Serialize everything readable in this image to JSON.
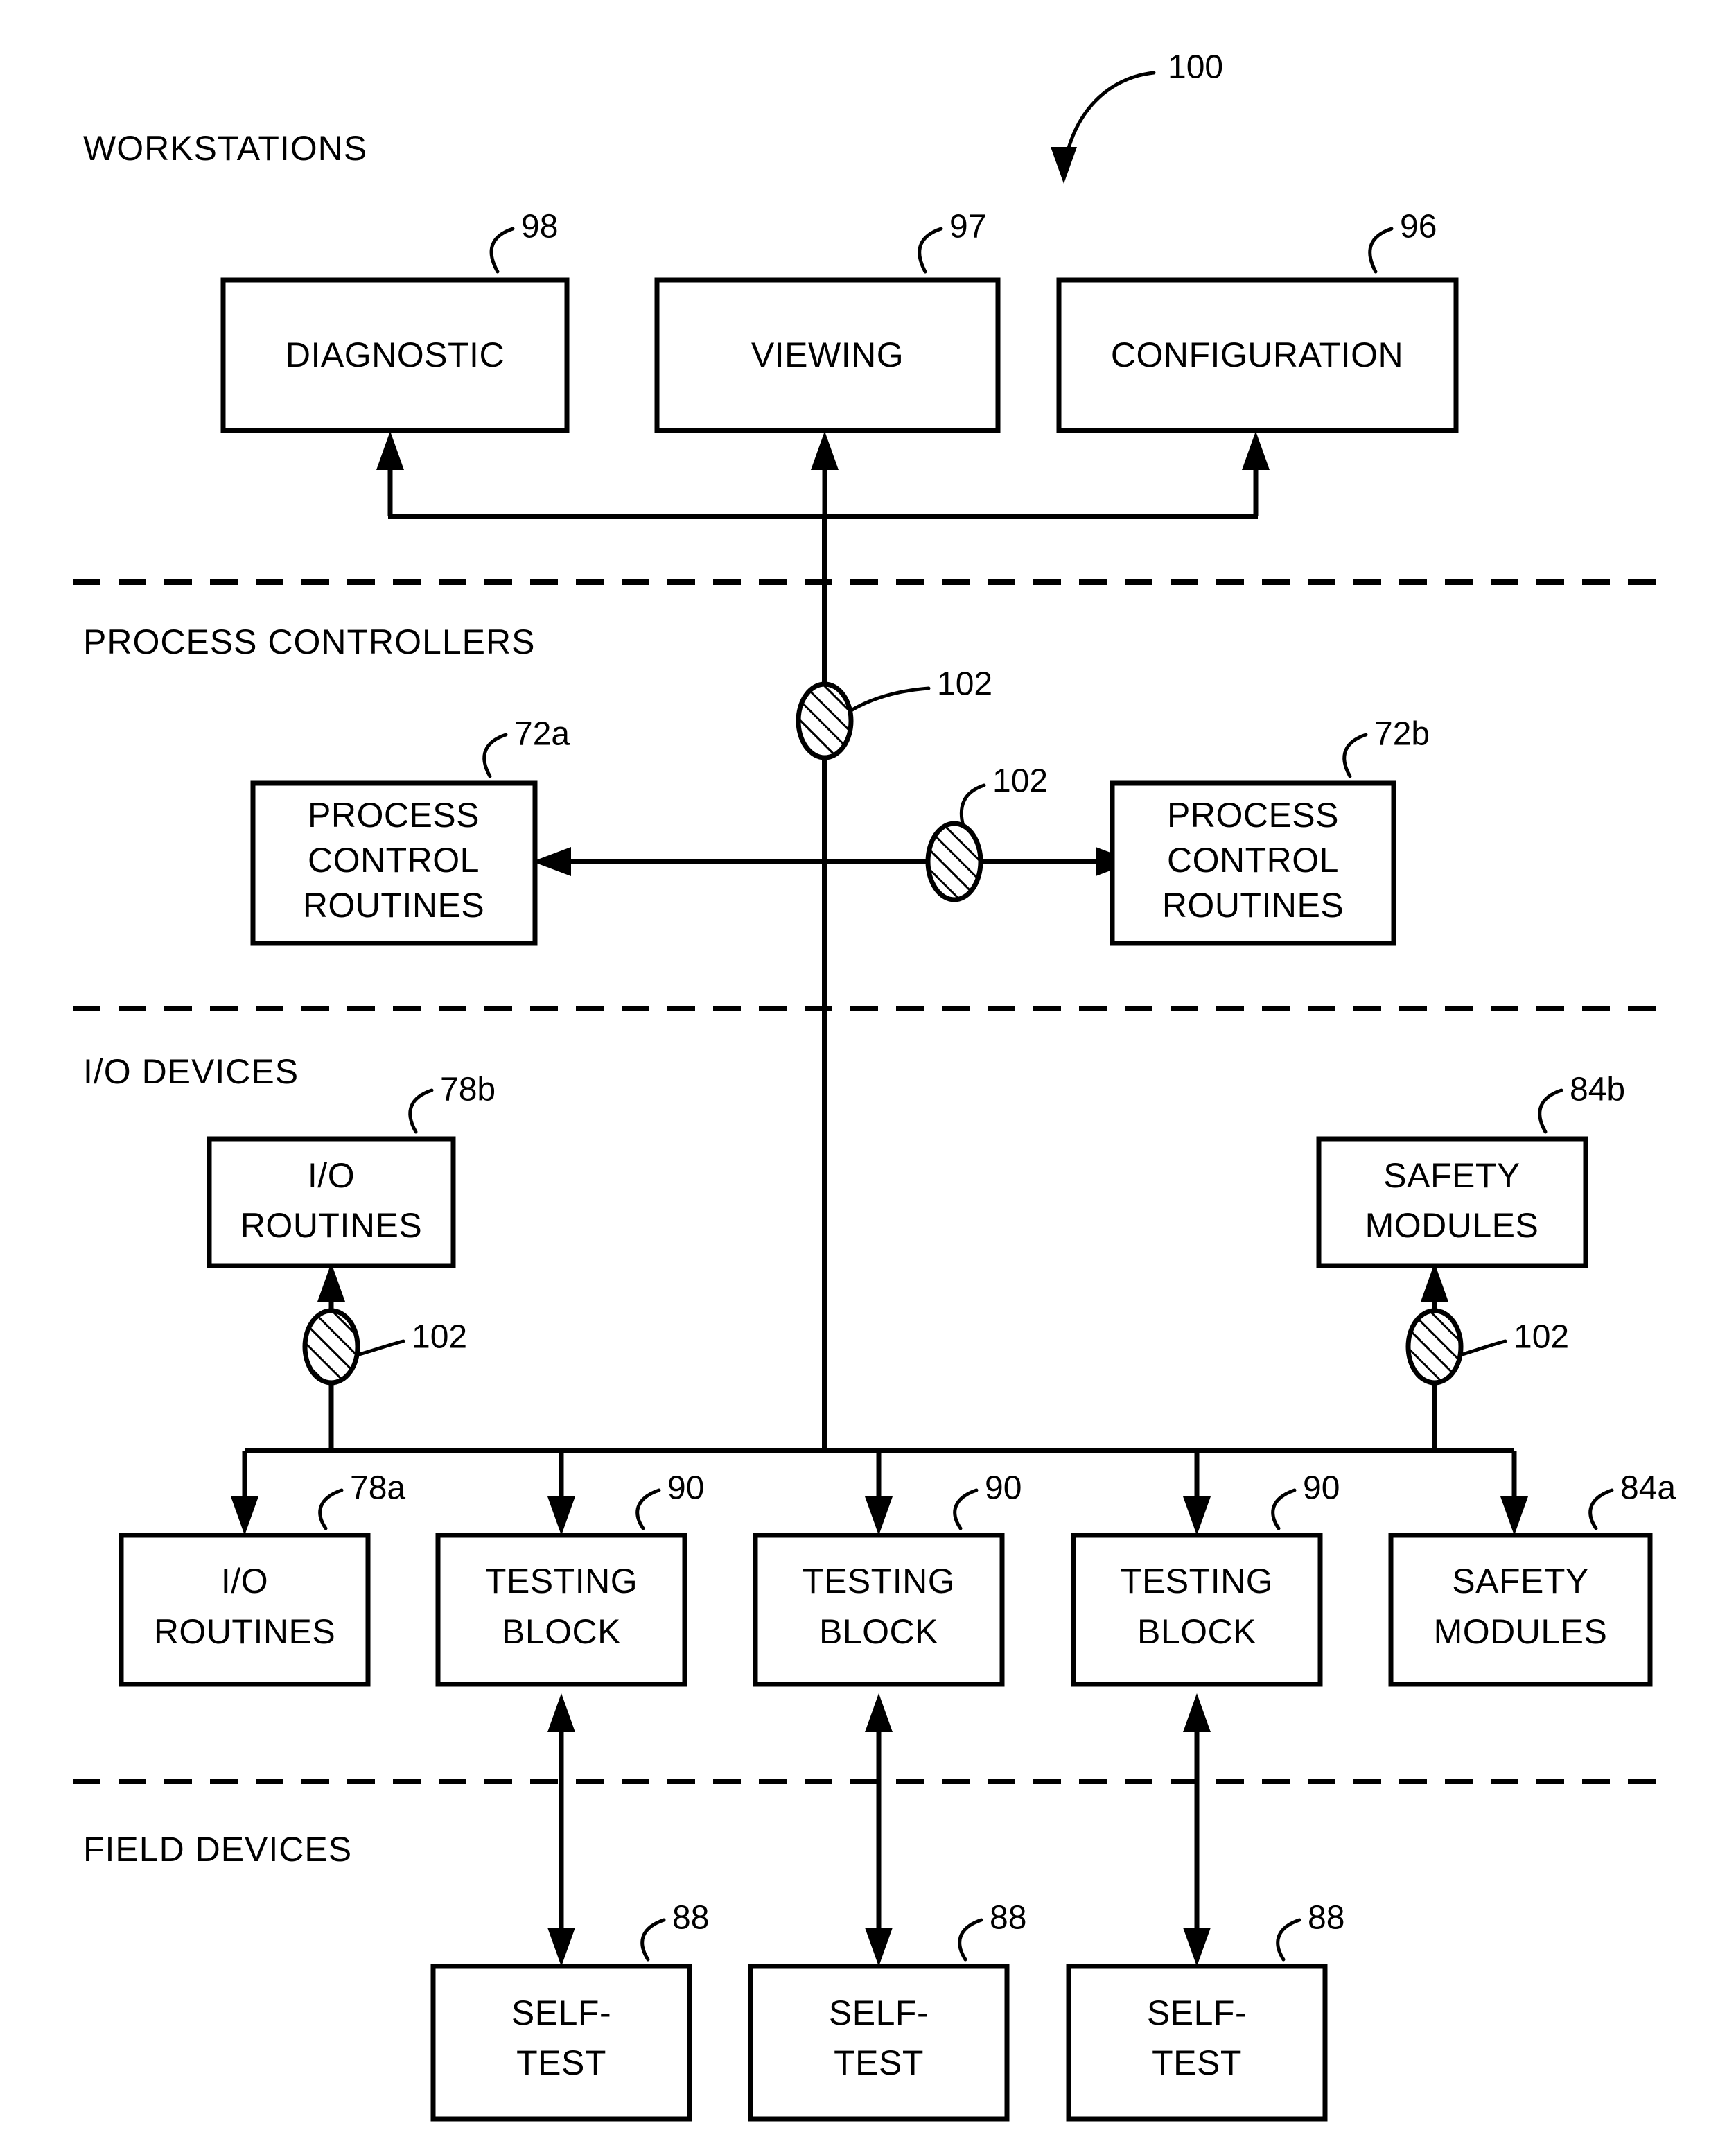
{
  "figure": {
    "main_reference": "100",
    "sections": [
      {
        "id": "workstations",
        "label": "WORKSTATIONS"
      },
      {
        "id": "process-controllers",
        "label": "PROCESS CONTROLLERS"
      },
      {
        "id": "io-devices",
        "label": "I/O DEVICES"
      },
      {
        "id": "field-devices",
        "label": "FIELD DEVICES"
      }
    ],
    "workstation_boxes": [
      {
        "id": "diagnostic",
        "label": "DIAGNOSTIC",
        "ref": "98"
      },
      {
        "id": "viewing",
        "label": "VIEWING",
        "ref": "97"
      },
      {
        "id": "configuration",
        "label": "CONFIGURATION",
        "ref": "96"
      }
    ],
    "controller_boxes": [
      {
        "id": "pcr-left",
        "line1": "PROCESS",
        "line2": "CONTROL",
        "line3": "ROUTINES",
        "ref": "72a"
      },
      {
        "id": "pcr-right",
        "line1": "PROCESS",
        "line2": "CONTROL",
        "line3": "ROUTINES",
        "ref": "72b"
      }
    ],
    "io_upper_boxes": [
      {
        "id": "io-routines-upper",
        "line1": "I/O",
        "line2": "ROUTINES",
        "ref": "78b"
      },
      {
        "id": "safety-modules-upper",
        "line1": "SAFETY",
        "line2": "MODULES",
        "ref": "84b"
      }
    ],
    "io_lower_boxes": [
      {
        "id": "io-routines-lower",
        "line1": "I/O",
        "line2": "ROUTINES",
        "ref": "78a"
      },
      {
        "id": "testing-block-1",
        "line1": "TESTING",
        "line2": "BLOCK",
        "ref": "90"
      },
      {
        "id": "testing-block-2",
        "line1": "TESTING",
        "line2": "BLOCK",
        "ref": "90"
      },
      {
        "id": "testing-block-3",
        "line1": "TESTING",
        "line2": "BLOCK",
        "ref": "90"
      },
      {
        "id": "safety-modules-lower",
        "line1": "SAFETY",
        "line2": "MODULES",
        "ref": "84a"
      }
    ],
    "field_boxes": [
      {
        "id": "self-test-1",
        "line1": "SELF-",
        "line2": "TEST",
        "ref": "88"
      },
      {
        "id": "self-test-2",
        "line1": "SELF-",
        "line2": "TEST",
        "ref": "88"
      },
      {
        "id": "self-test-3",
        "line1": "SELF-",
        "line2": "TEST",
        "ref": "88"
      }
    ],
    "bus_nodes": [
      {
        "id": "node-workstation-bus",
        "ref": "102"
      },
      {
        "id": "node-controller-bus",
        "ref": "102"
      },
      {
        "id": "node-io-left",
        "ref": "102"
      },
      {
        "id": "node-io-right",
        "ref": "102"
      }
    ],
    "colors": {
      "ink": "#000000",
      "paper": "#ffffff"
    }
  }
}
